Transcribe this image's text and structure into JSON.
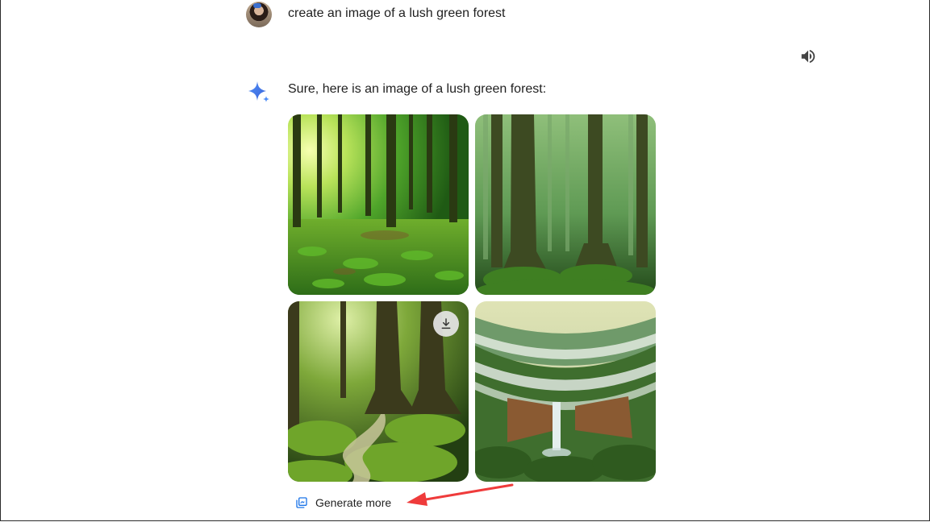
{
  "conversation": {
    "user_prompt": "create an image of a lush green forest",
    "assistant_reply": "Sure, here is an image of a lush green forest:"
  },
  "images": [
    {
      "description_icon": "forest-sunlight-image"
    },
    {
      "description_icon": "misty-forest-trees-image"
    },
    {
      "description_icon": "mossy-forest-path-image"
    },
    {
      "description_icon": "waterfall-valley-image"
    }
  ],
  "actions": {
    "generate_more_label": "Generate more",
    "download_icon": "download-icon",
    "speaker_icon": "speaker-icon"
  },
  "colors": {
    "accent_blue": "#1a73e8",
    "annotation_arrow": "#ef3b3b",
    "text": "#1f1f1f"
  }
}
